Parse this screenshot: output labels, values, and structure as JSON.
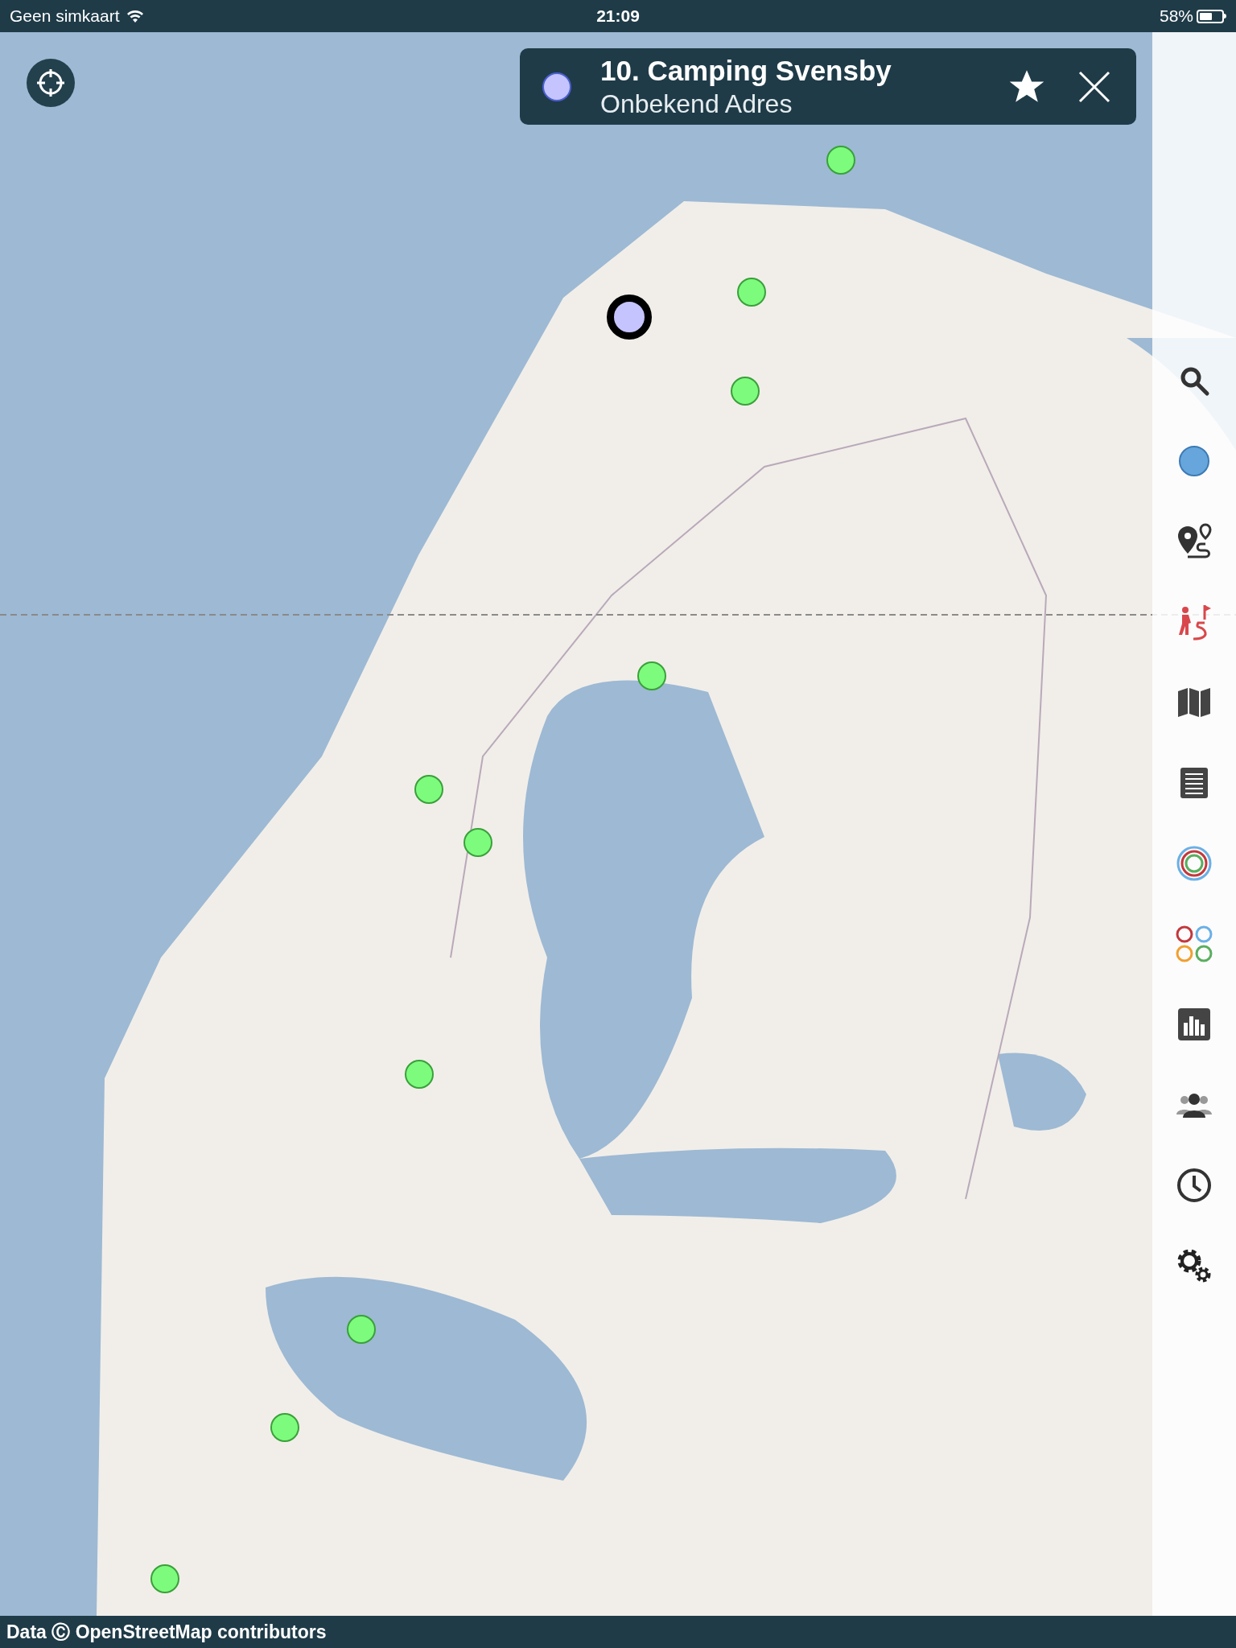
{
  "status_bar": {
    "carrier": "Geen simkaart",
    "time": "21:09",
    "battery": "58%"
  },
  "place_card": {
    "title": "10. Camping Svensby",
    "subtitle": "Onbekend Adres",
    "favorite": true
  },
  "markers": [
    {
      "selected": false
    },
    {
      "selected": false
    },
    {
      "selected": true
    },
    {
      "selected": false
    },
    {
      "selected": false
    },
    {
      "selected": false
    },
    {
      "selected": false
    },
    {
      "selected": false
    },
    {
      "selected": false
    },
    {
      "selected": false
    },
    {
      "selected": false
    }
  ],
  "attribution": "Data Ⓒ OpenStreetMap contributors"
}
